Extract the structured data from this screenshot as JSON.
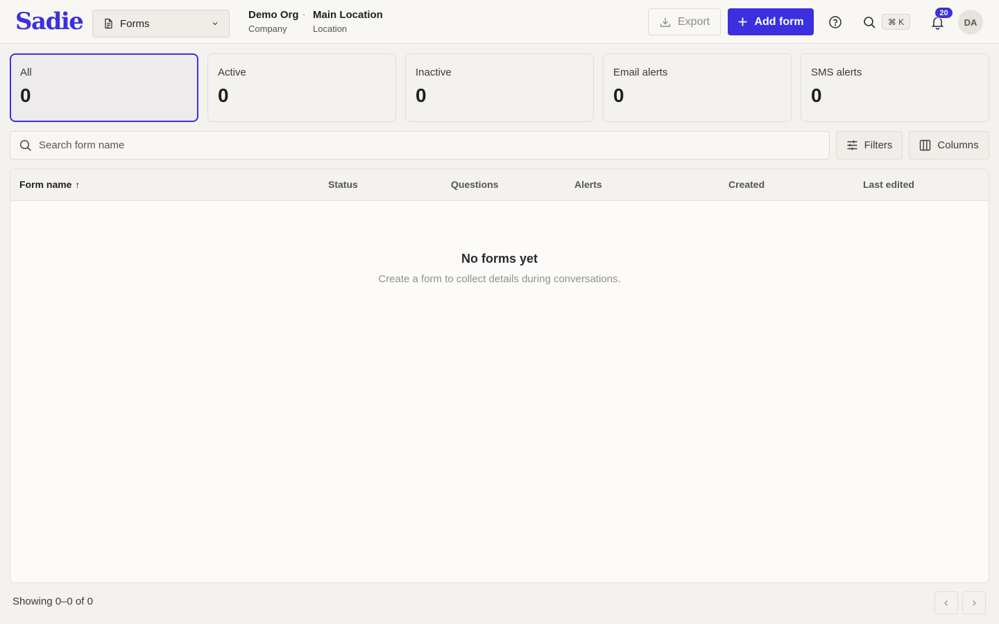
{
  "header": {
    "logo": "Sadie",
    "page_select": {
      "label": "Forms",
      "icon": "document-icon"
    },
    "org": {
      "name": "Demo Org",
      "type": "Company"
    },
    "separator": "·",
    "location": {
      "name": "Main Location",
      "type": "Location"
    },
    "export_label": "Export",
    "add_label": "Add form",
    "shortcut": "⌘ K",
    "notifications_count": "20",
    "avatar_initials": "DA",
    "accent": "#3b2fe0"
  },
  "stats": [
    {
      "label": "All",
      "value": "0"
    },
    {
      "label": "Active",
      "value": "0"
    },
    {
      "label": "Inactive",
      "value": "0"
    },
    {
      "label": "Email alerts",
      "value": "0"
    },
    {
      "label": "SMS alerts",
      "value": "0"
    }
  ],
  "search": {
    "placeholder": "Search form name",
    "value": ""
  },
  "filters_label": "Filters",
  "columns_label": "Columns",
  "table": {
    "columns": [
      "Form name",
      "Status",
      "Questions",
      "Alerts",
      "Created",
      "Last edited"
    ],
    "sort_indicator": "↑",
    "empty_title": "No forms yet",
    "empty_subtitle": "Create a form to collect details during conversations."
  },
  "footer": {
    "showing": "Showing 0–0 of 0"
  }
}
